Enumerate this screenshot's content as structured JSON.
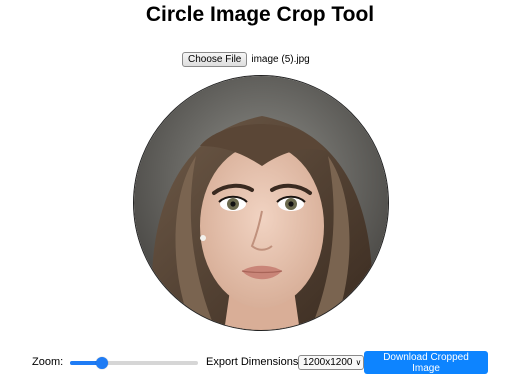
{
  "page": {
    "title": "Circle Image Crop Tool"
  },
  "file_input": {
    "button_label": "Choose File",
    "file_name": "image (5).jpg"
  },
  "preview": {
    "image_description": "portrait-photo"
  },
  "controls": {
    "zoom_label": "Zoom:",
    "zoom_value_fraction": 0.25,
    "export_label": "Export Dimensions:",
    "export_selected": "1200x1200",
    "download_label": "Download Cropped Image"
  },
  "colors": {
    "accent": "#0d84ff",
    "slider": "#1f7cf5"
  }
}
